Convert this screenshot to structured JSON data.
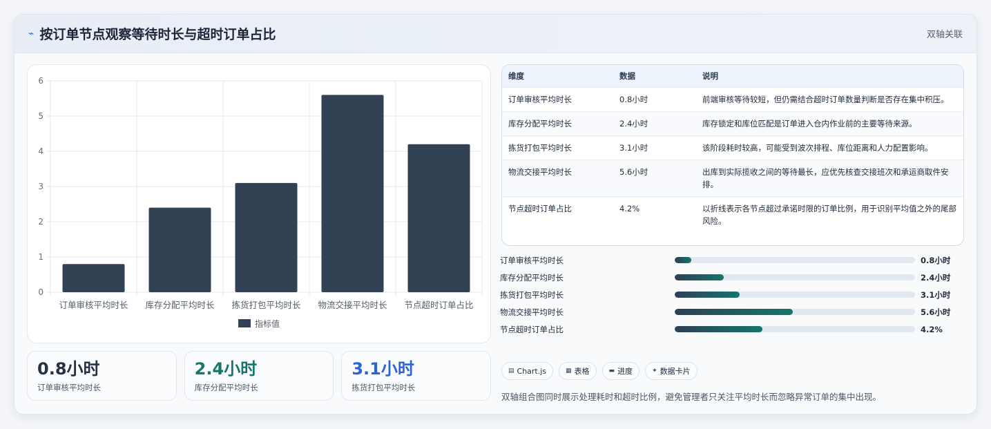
{
  "header": {
    "icon": "pulse-icon",
    "title": "按订单节点观察等待时长与超时订单占比",
    "tag": "双轴关联"
  },
  "chart_data": {
    "type": "bar",
    "categories": [
      "订单审核平均时长",
      "库存分配平均时长",
      "拣货打包平均时长",
      "物流交接平均时长",
      "节点超时订单占比"
    ],
    "series": [
      {
        "name": "指标值",
        "values": [
          0.8,
          2.4,
          3.1,
          5.6,
          4.2
        ]
      }
    ],
    "yticks": [
      "0",
      "1",
      "2",
      "3",
      "4",
      "5",
      "6"
    ],
    "ylim": [
      0,
      6
    ],
    "bar_color": "#334155",
    "legend_position": "bottom",
    "grid": true
  },
  "kpis": [
    {
      "value": "0.8小时",
      "label": "订单审核平均时长",
      "color": "#253244"
    },
    {
      "value": "2.4小时",
      "label": "库存分配平均时长",
      "color": "#17756b"
    },
    {
      "value": "3.1小时",
      "label": "拣货打包平均时长",
      "color": "#2b63d9"
    }
  ],
  "table": {
    "headers": [
      "维度",
      "数据",
      "说明"
    ],
    "rows": [
      [
        "订单审核平均时长",
        "0.8小时",
        "前端审核等待较短，但仍需结合超时订单数量判断是否存在集中积压。"
      ],
      [
        "库存分配平均时长",
        "2.4小时",
        "库存锁定和库位匹配是订单进入仓内作业前的主要等待来源。"
      ],
      [
        "拣货打包平均时长",
        "3.1小时",
        "该阶段耗时较高，可能受到波次排程、库位距离和人力配置影响。"
      ],
      [
        "物流交接平均时长",
        "5.6小时",
        "出库到实际揽收之间的等待最长，应优先核查交接班次和承运商取件安排。"
      ],
      [
        "节点超时订单占比",
        "4.2%",
        "以折线表示各节点超过承诺时限的订单比例，用于识别平均值之外的尾部风险。"
      ]
    ]
  },
  "progress": [
    {
      "label": "订单审核平均时长",
      "value": "0.8小时",
      "fraction": 0.07
    },
    {
      "label": "库存分配平均时长",
      "value": "2.4小时",
      "fraction": 0.205
    },
    {
      "label": "拣货打包平均时长",
      "value": "3.1小时",
      "fraction": 0.27
    },
    {
      "label": "物流交接平均时长",
      "value": "5.6小时",
      "fraction": 0.49
    },
    {
      "label": "节点超时订单占比",
      "value": "4.2%",
      "fraction": 0.365
    }
  ],
  "chips": [
    {
      "icon": "chart-icon",
      "glyph": "▤",
      "label": "Chart.js"
    },
    {
      "icon": "table-icon",
      "glyph": "▦",
      "label": "表格"
    },
    {
      "icon": "progress-icon",
      "glyph": "▬",
      "label": "进度"
    },
    {
      "icon": "card-icon",
      "glyph": "✦",
      "label": "数据卡片"
    }
  ],
  "note": "双轴组合图同时展示处理耗时和超时比例，避免管理者只关注平均时长而忽略异常订单的集中出现。"
}
